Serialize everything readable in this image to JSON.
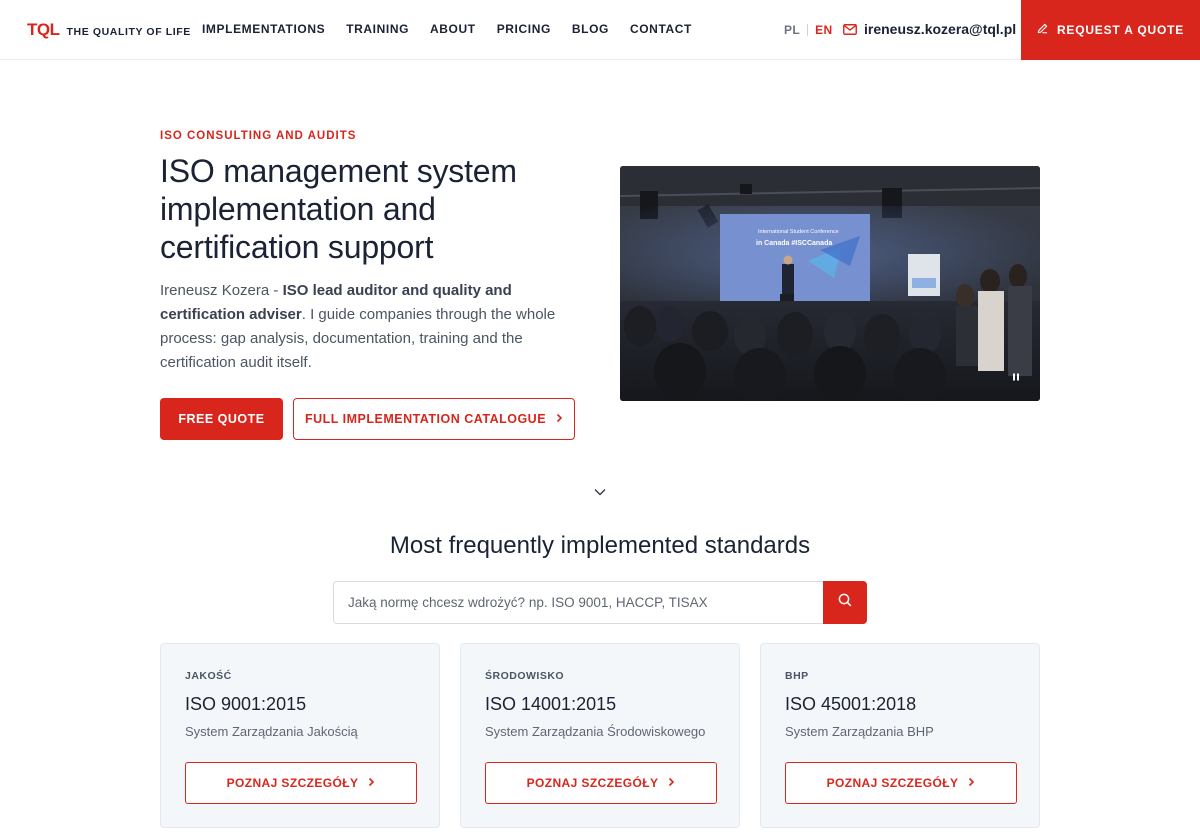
{
  "header": {
    "logo_mark": "TQL",
    "logo_tagline": "THE QUALITY OF LIFE",
    "nav": [
      "IMPLEMENTATIONS",
      "TRAINING",
      "ABOUT",
      "PRICING",
      "BLOG",
      "CONTACT"
    ],
    "lang": {
      "pl": "PL",
      "en": "EN",
      "active": "EN"
    },
    "email": "ireneusz.kozera@tql.pl",
    "quote_button": "REQUEST A QUOTE"
  },
  "hero": {
    "eyebrow": "ISO CONSULTING AND AUDITS",
    "title": "ISO management system implementation and certification support",
    "desc_name": "Ireneusz Kozera - ",
    "desc_bold": "ISO lead auditor and quality and certification adviser",
    "desc_rest": ". I guide companies through the whole process: gap analysis, documentation, training and the certification audit itself.",
    "primary_button": "FREE QUOTE",
    "secondary_button": "FULL IMPLEMENTATION CATALOGUE",
    "video_screen_text": "International Student Conference in Canada #ISCCanada"
  },
  "standards": {
    "title": "Most frequently implemented standards",
    "search_placeholder": "Jaką normę chcesz wdrożyć? np. ISO 9001, HACCP, TISAX",
    "cards": [
      {
        "category": "JAKOŚĆ",
        "standard": "ISO 9001:2015",
        "description": "System Zarządzania Jakością",
        "button": "POZNAJ SZCZEGÓŁY"
      },
      {
        "category": "ŚRODOWISKO",
        "standard": "ISO 14001:2015",
        "description": "System Zarządzania Środowiskowego",
        "button": "POZNAJ SZCZEGÓŁY"
      },
      {
        "category": "BHP",
        "standard": "ISO 45001:2018",
        "description": "System Zarządzania BHP",
        "button": "POZNAJ SZCZEGÓŁY"
      }
    ]
  },
  "icons": [
    "mail-icon",
    "pencil-icon",
    "chevron-right-icon",
    "pause-icon",
    "chevron-down-icon",
    "search-icon"
  ],
  "colors": {
    "accent": "#d9261c",
    "text": "#1a2233",
    "card_bg": "#f4f7fa"
  }
}
